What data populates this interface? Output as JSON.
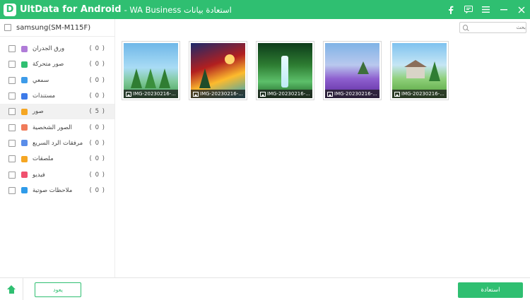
{
  "title_bar": {
    "app_name": "UltData for Android",
    "subtitle": " - WA Business استعادة بيانات",
    "logo_letter": "D",
    "controls": [
      "facebook-icon",
      "feedback-icon",
      "menu-icon",
      "minimize-icon",
      "close-icon"
    ]
  },
  "device": {
    "name": "samsung(SM-M115F)"
  },
  "categories": [
    {
      "label": "ورق الجدران",
      "count": "( 0 )",
      "icon": "wallpaper-icon",
      "color": "#b07cd8"
    },
    {
      "label": "صور متحركة",
      "count": "( 0 )",
      "icon": "gif-icon",
      "color": "#2fbf71"
    },
    {
      "label": "سمعي",
      "count": "( 0 )",
      "icon": "microphone-icon",
      "color": "#3d9be9"
    },
    {
      "label": "مستندات",
      "count": "( 0 )",
      "icon": "document-icon",
      "color": "#3d7be9"
    },
    {
      "label": "صور",
      "count": "( 5 )",
      "icon": "photo-icon",
      "color": "#f5a623"
    },
    {
      "label": "الصور الشخصية",
      "count": "( 0 )",
      "icon": "profile-photo-icon",
      "color": "#f07b5a"
    },
    {
      "label": "مرفقات الرد السريع",
      "count": "( 0 )",
      "icon": "attachment-icon",
      "color": "#5a8de9"
    },
    {
      "label": "ملصقات",
      "count": "( 0 )",
      "icon": "sticker-icon",
      "color": "#f5a623"
    },
    {
      "label": "فيديو",
      "count": "( 0 )",
      "icon": "video-icon",
      "color": "#f0506e"
    },
    {
      "label": "ملاحظات صوتية",
      "count": "( 0 )",
      "icon": "voice-note-icon",
      "color": "#2f9be9"
    }
  ],
  "search": {
    "placeholder": "بحث"
  },
  "photos": [
    {
      "caption": "IMG-20230216-..."
    },
    {
      "caption": "IMG-20230216-..."
    },
    {
      "caption": "IMG-20230216-..."
    },
    {
      "caption": "IMG-20230216-..."
    },
    {
      "caption": "IMG-20230216-..."
    }
  ],
  "footer": {
    "back_label": "يعود",
    "restore_label": "استعادة"
  },
  "colors": {
    "accent": "#2fbf71"
  }
}
